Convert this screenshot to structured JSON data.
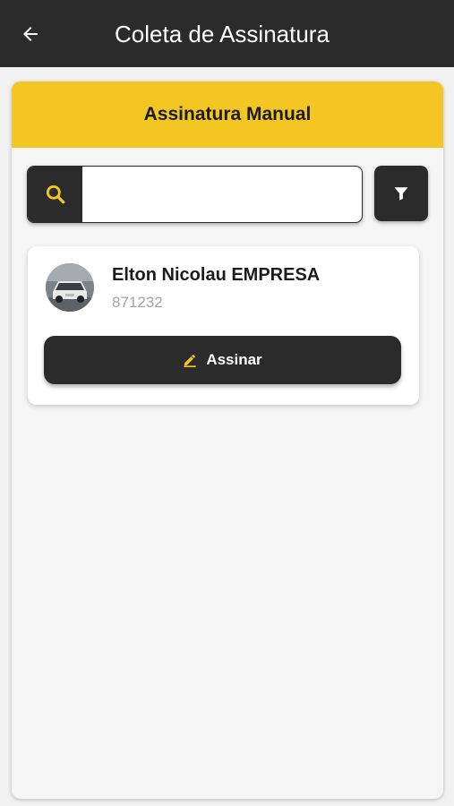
{
  "appbar": {
    "title": "Coleta de Assinatura",
    "back_icon": "arrow-left-icon"
  },
  "panel": {
    "title": "Assinatura Manual",
    "header_color": "#f3c623"
  },
  "search": {
    "value": "",
    "placeholder": "",
    "icon": "search-icon",
    "icon_color": "#f3c623"
  },
  "filter": {
    "icon": "filter-icon"
  },
  "results": [
    {
      "name": "Elton Nicolau EMPRESA",
      "code": "871232",
      "action_label": "Assinar",
      "action_icon": "pencil-icon"
    }
  ],
  "colors": {
    "dark": "#2b2b2b",
    "accent": "#f3c623",
    "muted_text": "#a3a3a3"
  }
}
